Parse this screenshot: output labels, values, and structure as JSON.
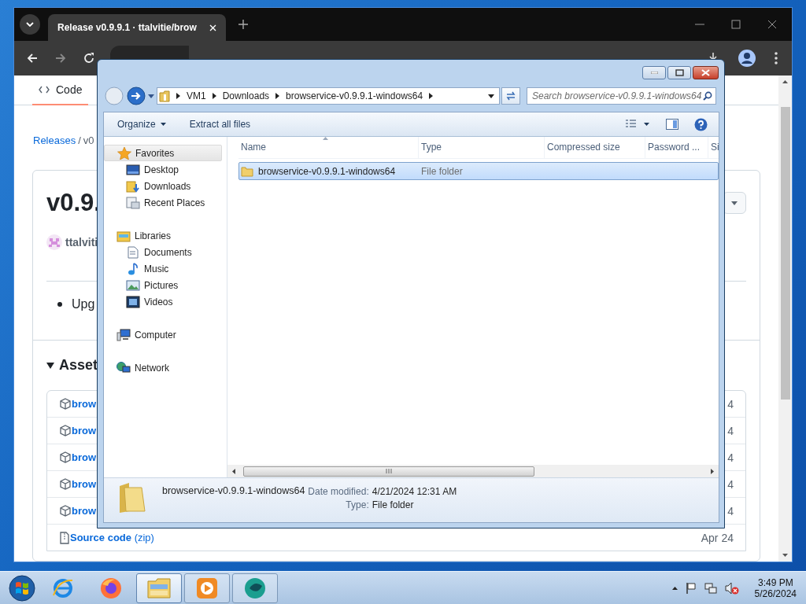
{
  "browser": {
    "tab": {
      "title": "Release v0.9.9.1 · ttalvitie/brow",
      "selected": true
    },
    "page": {
      "repo_tab": {
        "label": "Code",
        "selected": true
      },
      "breadcrumb": [
        {
          "label": "Releases"
        },
        {
          "label": "v0"
        }
      ],
      "breadcrumb_separator": "/",
      "release_title": "v0.9.",
      "author": "ttalviti",
      "notes": [
        "Upg"
      ],
      "assets_heading": "Asset",
      "assets": [
        {
          "kind": "package",
          "name": "brow",
          "date": "4"
        },
        {
          "kind": "package",
          "name": "brow",
          "date": "4"
        },
        {
          "kind": "package",
          "name": "brow",
          "date": "4"
        },
        {
          "kind": "package",
          "name": "brow",
          "date": "4"
        },
        {
          "kind": "package",
          "name": "brow",
          "date": "4"
        },
        {
          "kind": "source",
          "name": "Source code",
          "suffix": "(zip)",
          "date": "Apr 24"
        }
      ]
    }
  },
  "explorer": {
    "path": [
      "VM1",
      "Downloads",
      "browservice-v0.9.9.1-windows64"
    ],
    "search": {
      "placeholder": "Search browservice-v0.9.9.1-windows64"
    },
    "toolbar": [
      {
        "label": "Organize",
        "dropdown": true
      },
      {
        "label": "Extract all files",
        "dropdown": false
      }
    ],
    "nav": [
      {
        "label": "Favorites",
        "kind": "favorites",
        "selected": true,
        "children": [
          {
            "label": "Desktop",
            "kind": "desktop",
            "selected": false
          },
          {
            "label": "Downloads",
            "kind": "downloads",
            "selected": false
          },
          {
            "label": "Recent Places",
            "kind": "recent",
            "selected": false
          }
        ]
      },
      {
        "label": "Libraries",
        "kind": "libraries",
        "selected": false,
        "children": [
          {
            "label": "Documents",
            "kind": "documents",
            "selected": false
          },
          {
            "label": "Music",
            "kind": "music",
            "selected": false
          },
          {
            "label": "Pictures",
            "kind": "pictures",
            "selected": false
          },
          {
            "label": "Videos",
            "kind": "videos",
            "selected": false
          }
        ]
      },
      {
        "label": "Computer",
        "kind": "computer",
        "selected": false
      },
      {
        "label": "Network",
        "kind": "network",
        "selected": false
      }
    ],
    "columns": [
      "Name",
      "Type",
      "Compressed size",
      "Password ...",
      "Si"
    ],
    "rows": [
      {
        "name": "browservice-v0.9.9.1-windows64",
        "type": "File folder",
        "selected": true
      }
    ],
    "details": {
      "name": "browservice-v0.9.9.1-windows64",
      "fields": [
        {
          "label": "Date modified:",
          "value": "4/21/2024 12:31 AM"
        },
        {
          "label": "Type:",
          "value": "File folder"
        }
      ]
    }
  },
  "taskbar": {
    "apps": [
      {
        "kind": "ie",
        "running": false,
        "selected": false
      },
      {
        "kind": "firefox",
        "running": false,
        "selected": false
      },
      {
        "kind": "explorer",
        "running": true,
        "selected": true
      },
      {
        "kind": "media",
        "running": true,
        "selected": false
      },
      {
        "kind": "app",
        "running": true,
        "selected": false
      }
    ],
    "time": "3:49 PM",
    "date": "5/26/2024"
  }
}
